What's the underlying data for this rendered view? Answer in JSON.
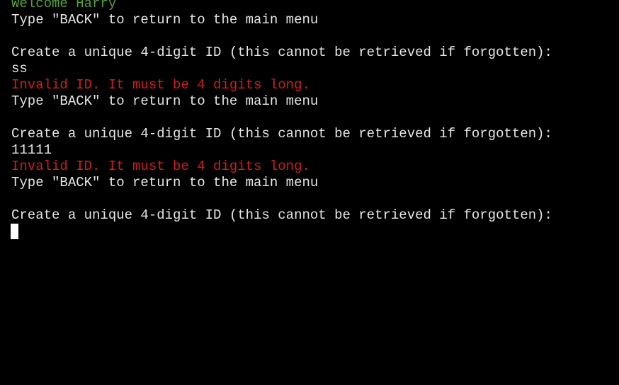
{
  "terminal": {
    "colors": {
      "background": "#000000",
      "text": "#e6e6e6",
      "success": "#55a332",
      "error": "#d31c1c",
      "cursor": "#ffffff"
    },
    "lines": [
      {
        "text": "Welcome Harry",
        "kind": "success"
      },
      {
        "text": "Type \"BACK\" to return to the main menu",
        "kind": "normal"
      },
      {
        "text": "",
        "kind": "blank"
      },
      {
        "text": "Create a unique 4-digit ID (this cannot be retrieved if forgotten):",
        "kind": "prompt"
      },
      {
        "text": "ss",
        "kind": "input"
      },
      {
        "text": "Invalid ID. It must be 4 digits long.",
        "kind": "error"
      },
      {
        "text": "Type \"BACK\" to return to the main menu",
        "kind": "normal"
      },
      {
        "text": "",
        "kind": "blank"
      },
      {
        "text": "Create a unique 4-digit ID (this cannot be retrieved if forgotten):",
        "kind": "prompt"
      },
      {
        "text": "11111",
        "kind": "input"
      },
      {
        "text": "Invalid ID. It must be 4 digits long.",
        "kind": "error"
      },
      {
        "text": "Type \"BACK\" to return to the main menu",
        "kind": "normal"
      },
      {
        "text": "",
        "kind": "blank"
      },
      {
        "text": "Create a unique 4-digit ID (this cannot be retrieved if forgotten):",
        "kind": "prompt"
      }
    ]
  }
}
